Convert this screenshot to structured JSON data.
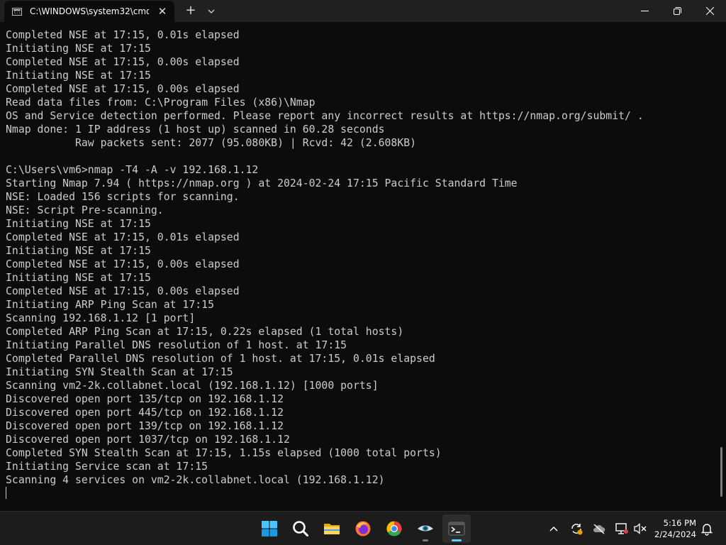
{
  "window": {
    "tab_title": "C:\\WINDOWS\\system32\\cmd.",
    "tab_icon": "cmd-icon",
    "new_tab_label": "+",
    "close_tab_label": "✕"
  },
  "terminal": {
    "lines": [
      "Completed NSE at 17:15, 0.01s elapsed",
      "Initiating NSE at 17:15",
      "Completed NSE at 17:15, 0.00s elapsed",
      "Initiating NSE at 17:15",
      "Completed NSE at 17:15, 0.00s elapsed",
      "Read data files from: C:\\Program Files (x86)\\Nmap",
      "OS and Service detection performed. Please report any incorrect results at https://nmap.org/submit/ .",
      "Nmap done: 1 IP address (1 host up) scanned in 60.28 seconds",
      "           Raw packets sent: 2077 (95.080KB) | Rcvd: 42 (2.608KB)",
      "",
      "C:\\Users\\vm6>nmap -T4 -A -v 192.168.1.12",
      "Starting Nmap 7.94 ( https://nmap.org ) at 2024-02-24 17:15 Pacific Standard Time",
      "NSE: Loaded 156 scripts for scanning.",
      "NSE: Script Pre-scanning.",
      "Initiating NSE at 17:15",
      "Completed NSE at 17:15, 0.01s elapsed",
      "Initiating NSE at 17:15",
      "Completed NSE at 17:15, 0.00s elapsed",
      "Initiating NSE at 17:15",
      "Completed NSE at 17:15, 0.00s elapsed",
      "Initiating ARP Ping Scan at 17:15",
      "Scanning 192.168.1.12 [1 port]",
      "Completed ARP Ping Scan at 17:15, 0.22s elapsed (1 total hosts)",
      "Initiating Parallel DNS resolution of 1 host. at 17:15",
      "Completed Parallel DNS resolution of 1 host. at 17:15, 0.01s elapsed",
      "Initiating SYN Stealth Scan at 17:15",
      "Scanning vm2-2k.collabnet.local (192.168.1.12) [1000 ports]",
      "Discovered open port 135/tcp on 192.168.1.12",
      "Discovered open port 445/tcp on 192.168.1.12",
      "Discovered open port 139/tcp on 192.168.1.12",
      "Discovered open port 1037/tcp on 192.168.1.12",
      "Completed SYN Stealth Scan at 17:15, 1.15s elapsed (1000 total ports)",
      "Initiating Service scan at 17:15",
      "Scanning 4 services on vm2-2k.collabnet.local (192.168.1.12)"
    ],
    "colors": {
      "background": "#0c0c0c",
      "foreground": "#cccccc"
    }
  },
  "taskbar": {
    "apps": [
      {
        "name": "start-icon"
      },
      {
        "name": "search-icon"
      },
      {
        "name": "file-explorer-icon"
      },
      {
        "name": "firefox-icon"
      },
      {
        "name": "chrome-icon"
      },
      {
        "name": "eye-app-icon"
      },
      {
        "name": "terminal-icon",
        "active": true
      }
    ],
    "tray": [
      "chevron-up-icon",
      "sync-icon",
      "cloud-offline-icon",
      "network-icon",
      "volume-muted-icon",
      "notification-bell-icon"
    ],
    "time": "5:16 PM",
    "date": "2/24/2024",
    "accent": "#60cdff"
  }
}
